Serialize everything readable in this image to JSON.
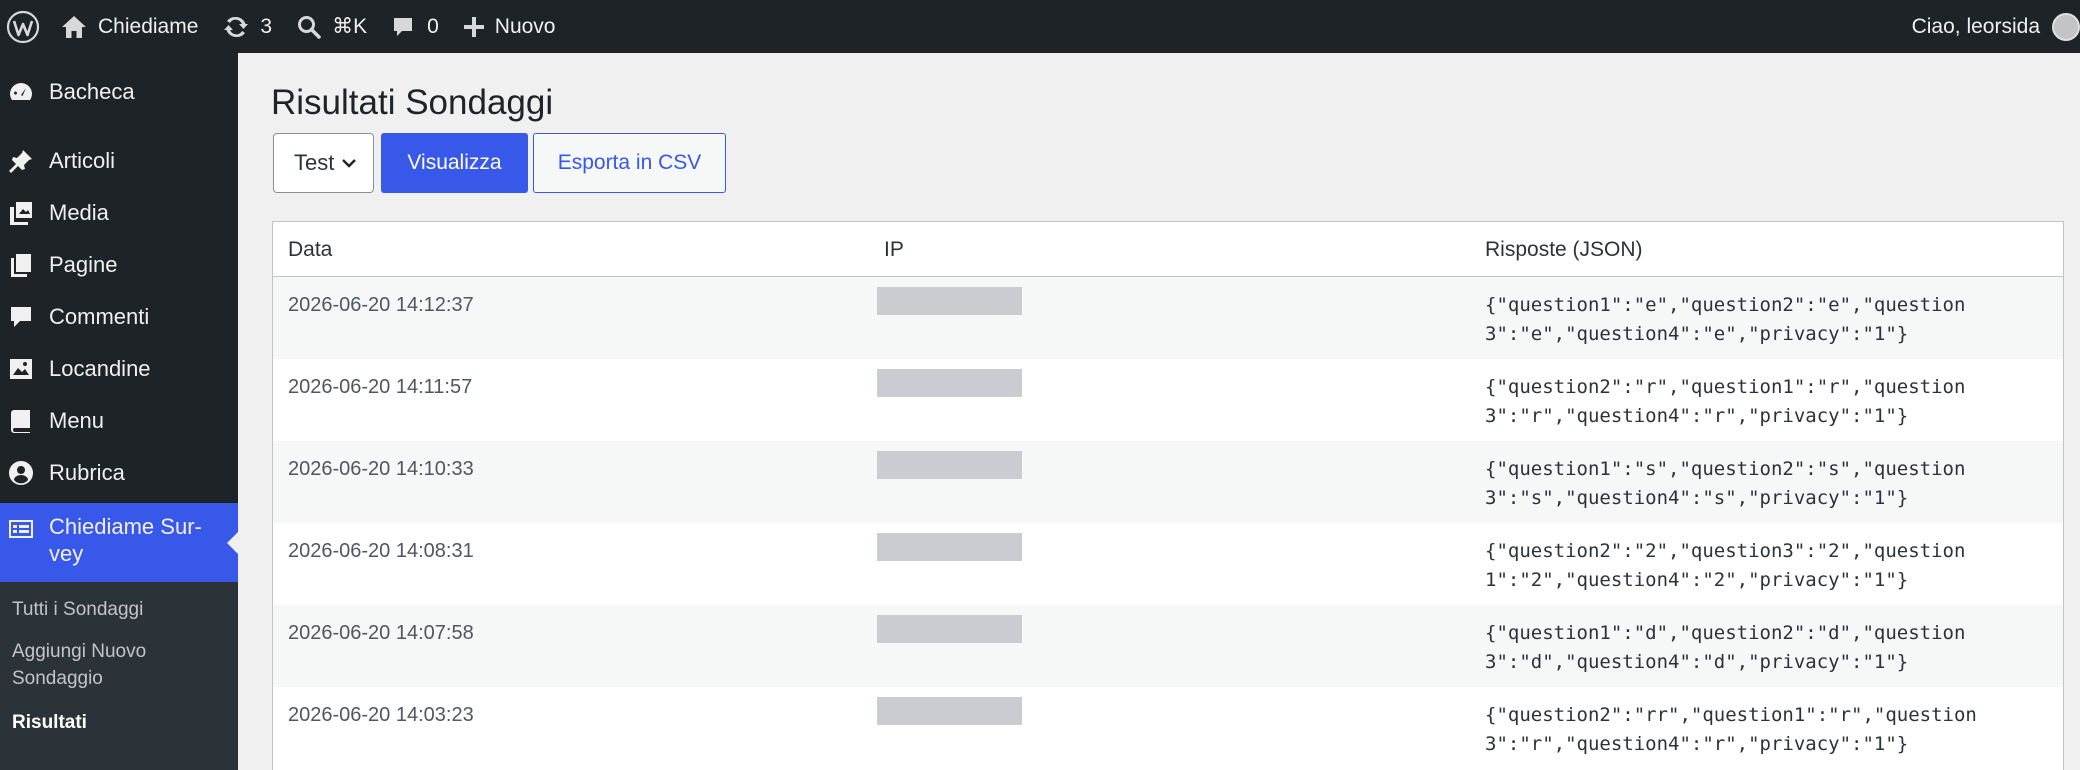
{
  "adminbar": {
    "site_name": "Chiediame",
    "updates_count": "3",
    "search_shortcut": "⌘K",
    "comments_count": "0",
    "new_label": "Nuovo",
    "greeting": "Ciao, leorsida"
  },
  "sidebar": {
    "items": [
      {
        "label": "Bacheca",
        "icon": "dashboard-icon"
      },
      {
        "label": "Articoli",
        "icon": "pin-icon"
      },
      {
        "label": "Media",
        "icon": "media-icon"
      },
      {
        "label": "Pagine",
        "icon": "pages-icon"
      },
      {
        "label": "Commenti",
        "icon": "comment-icon"
      },
      {
        "label": "Locandine",
        "icon": "image-icon"
      },
      {
        "label": "Menu",
        "icon": "book-icon"
      },
      {
        "label": "Rubrica",
        "icon": "contacts-icon"
      },
      {
        "label": "Chiediame Sur-\nvey",
        "icon": "survey-icon"
      }
    ],
    "submenu": [
      {
        "label": "Tutti i Sondaggi"
      },
      {
        "label": "Aggiungi Nuovo\nSondaggio"
      },
      {
        "label": "Risultati"
      }
    ]
  },
  "main": {
    "title": "Risultati Sondaggi",
    "select_value": "Test",
    "view_button": "Visualizza",
    "export_button": "Esporta in CSV",
    "table": {
      "headers": [
        "Data",
        "IP",
        "Risposte (JSON)"
      ],
      "rows": [
        {
          "date": "2026-06-20 14:12:37",
          "json": "{\"question1\":\"e\",\"question2\":\"e\",\"question3\":\"e\",\"question4\":\"e\",\"privacy\":\"1\"}"
        },
        {
          "date": "2026-06-20 14:11:57",
          "json": "{\"question2\":\"r\",\"question1\":\"r\",\"question3\":\"r\",\"question4\":\"r\",\"privacy\":\"1\"}"
        },
        {
          "date": "2026-06-20 14:10:33",
          "json": "{\"question1\":\"s\",\"question2\":\"s\",\"question3\":\"s\",\"question4\":\"s\",\"privacy\":\"1\"}"
        },
        {
          "date": "2026-06-20 14:08:31",
          "json": "{\"question2\":\"2\",\"question3\":\"2\",\"question1\":\"2\",\"question4\":\"2\",\"privacy\":\"1\"}"
        },
        {
          "date": "2026-06-20 14:07:58",
          "json": "{\"question1\":\"d\",\"question2\":\"d\",\"question3\":\"d\",\"question4\":\"d\",\"privacy\":\"1\"}"
        },
        {
          "date": "2026-06-20 14:03:23",
          "json": "{\"question2\":\"rr\",\"question1\":\"r\",\"question3\":\"r\",\"question4\":\"r\",\"privacy\":\"1\"}"
        }
      ]
    }
  },
  "colors": {
    "accent": "#3858e9",
    "adminbar_bg": "#1d2327",
    "ip_mask": "#c9ccd1"
  }
}
